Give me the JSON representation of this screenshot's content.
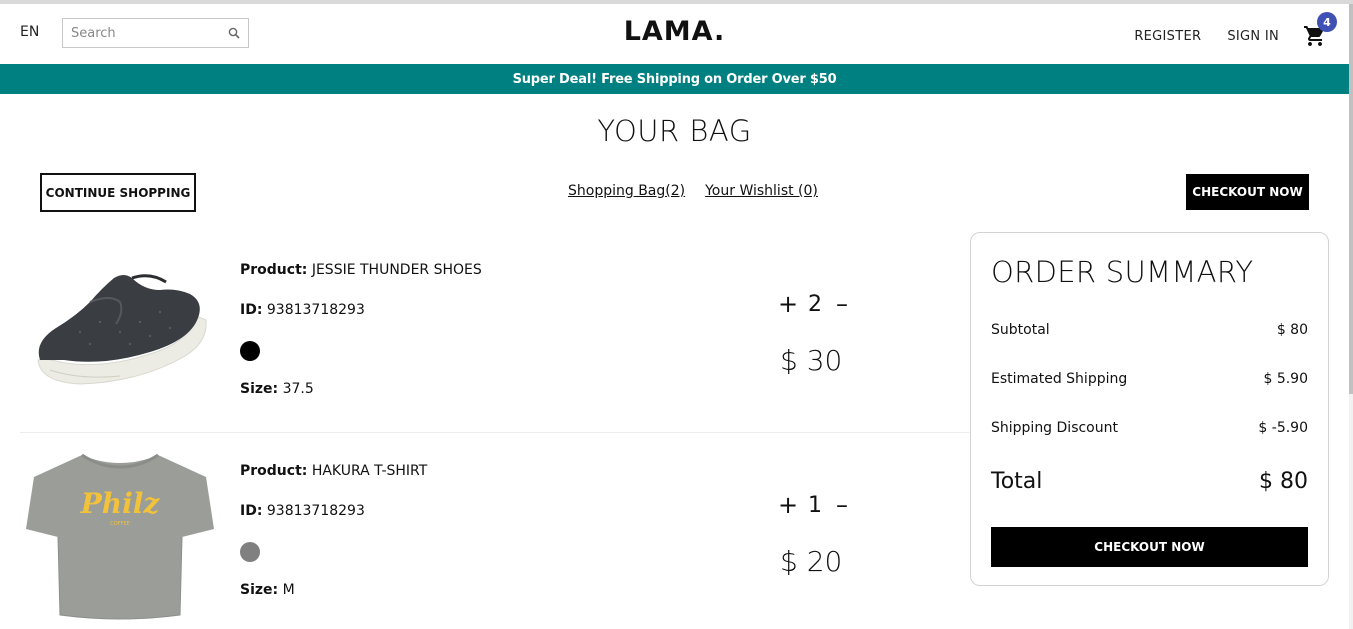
{
  "navbar": {
    "language": "EN",
    "search_placeholder": "Search",
    "logo": "LAMA.",
    "register": "REGISTER",
    "sign_in": "SIGN IN",
    "cart_count": "4"
  },
  "announcement": "Super Deal! Free Shipping on Order Over $50",
  "page": {
    "title": "YOUR BAG",
    "continue_shopping": "CONTINUE SHOPPING",
    "shopping_bag_link": "Shopping Bag(2)",
    "wishlist_link": "Your Wishlist (0)",
    "checkout_top": "CHECKOUT NOW"
  },
  "products": [
    {
      "product_label": "Product:",
      "name": "JESSIE THUNDER SHOES",
      "id_label": "ID:",
      "id": "93813718293",
      "color": "#000000",
      "size_label": "Size:",
      "size": "37.5",
      "quantity": "2",
      "price": "$ 30",
      "image": "sneaker-image"
    },
    {
      "product_label": "Product:",
      "name": "HAKURA T-SHIRT",
      "id_label": "ID:",
      "id": "93813718293",
      "color": "#808080",
      "size_label": "Size:",
      "size": "M",
      "quantity": "1",
      "price": "$ 20",
      "image": "tshirt-image"
    }
  ],
  "summary": {
    "title": "ORDER SUMMARY",
    "subtotal_label": "Subtotal",
    "subtotal": "$ 80",
    "shipping_label": "Estimated Shipping",
    "shipping": "$ 5.90",
    "discount_label": "Shipping Discount",
    "discount": "$ -5.90",
    "total_label": "Total",
    "total": "$ 80",
    "checkout": "CHECKOUT NOW"
  },
  "colors": {
    "accent": "#008080",
    "badge": "#3f51b5"
  }
}
